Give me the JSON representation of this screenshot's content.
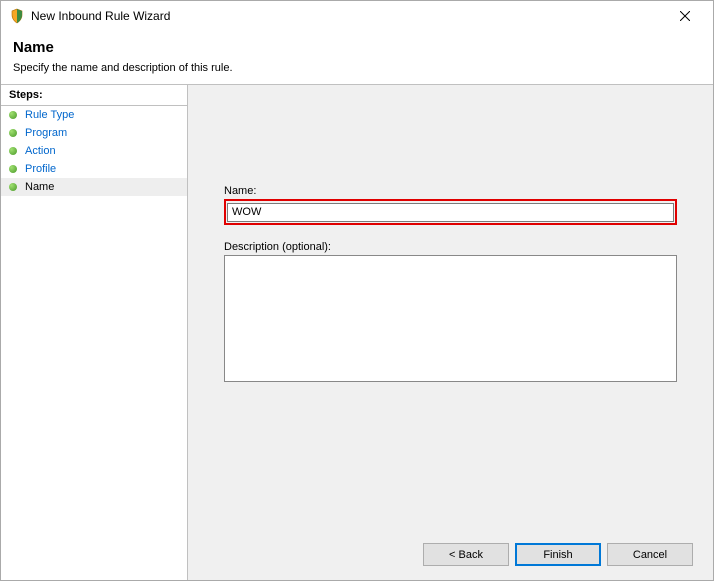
{
  "titlebar": {
    "title": "New Inbound Rule Wizard"
  },
  "header": {
    "title": "Name",
    "subtitle": "Specify the name and description of this rule."
  },
  "sidebar": {
    "header": "Steps:",
    "items": [
      {
        "label": "Rule Type"
      },
      {
        "label": "Program"
      },
      {
        "label": "Action"
      },
      {
        "label": "Profile"
      },
      {
        "label": "Name"
      }
    ]
  },
  "form": {
    "name_label": "Name:",
    "name_value": "WOW",
    "desc_label": "Description (optional):",
    "desc_value": ""
  },
  "buttons": {
    "back": "< Back",
    "finish": "Finish",
    "cancel": "Cancel"
  }
}
